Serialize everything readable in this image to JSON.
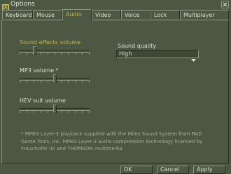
{
  "window": {
    "title": "Options"
  },
  "tabs": [
    {
      "label": "Keyboard"
    },
    {
      "label": "Mouse"
    },
    {
      "label": "Audio"
    },
    {
      "label": "Video"
    },
    {
      "label": "Voice"
    },
    {
      "label": "Lock"
    },
    {
      "label": "Multiplayer"
    }
  ],
  "active_tab": "Audio",
  "audio": {
    "sound_effects_volume": {
      "label": "Sound effects volume",
      "value_fraction": 0.2
    },
    "mp3_volume": {
      "label": "MP3 volume *",
      "value_fraction": 0.5
    },
    "hev_suit_volume": {
      "label": "HEV suit volume",
      "value_fraction": 0.5
    },
    "sound_quality": {
      "label": "Sound quality",
      "selected": "High"
    },
    "footnote": "* MPEG Layer-3 playback supplied with the Miles Sound System from RAD Game Tools, Inc. MPEG Layer-3 audio compression technology licensed by Fraunhofer IIS and THOMSON multimedia."
  },
  "buttons": {
    "ok": "OK",
    "cancel": "Cancel",
    "apply": "Apply"
  },
  "colors": {
    "background": "#4c5844",
    "text": "#dedfd6",
    "highlight": "#c4b550"
  }
}
